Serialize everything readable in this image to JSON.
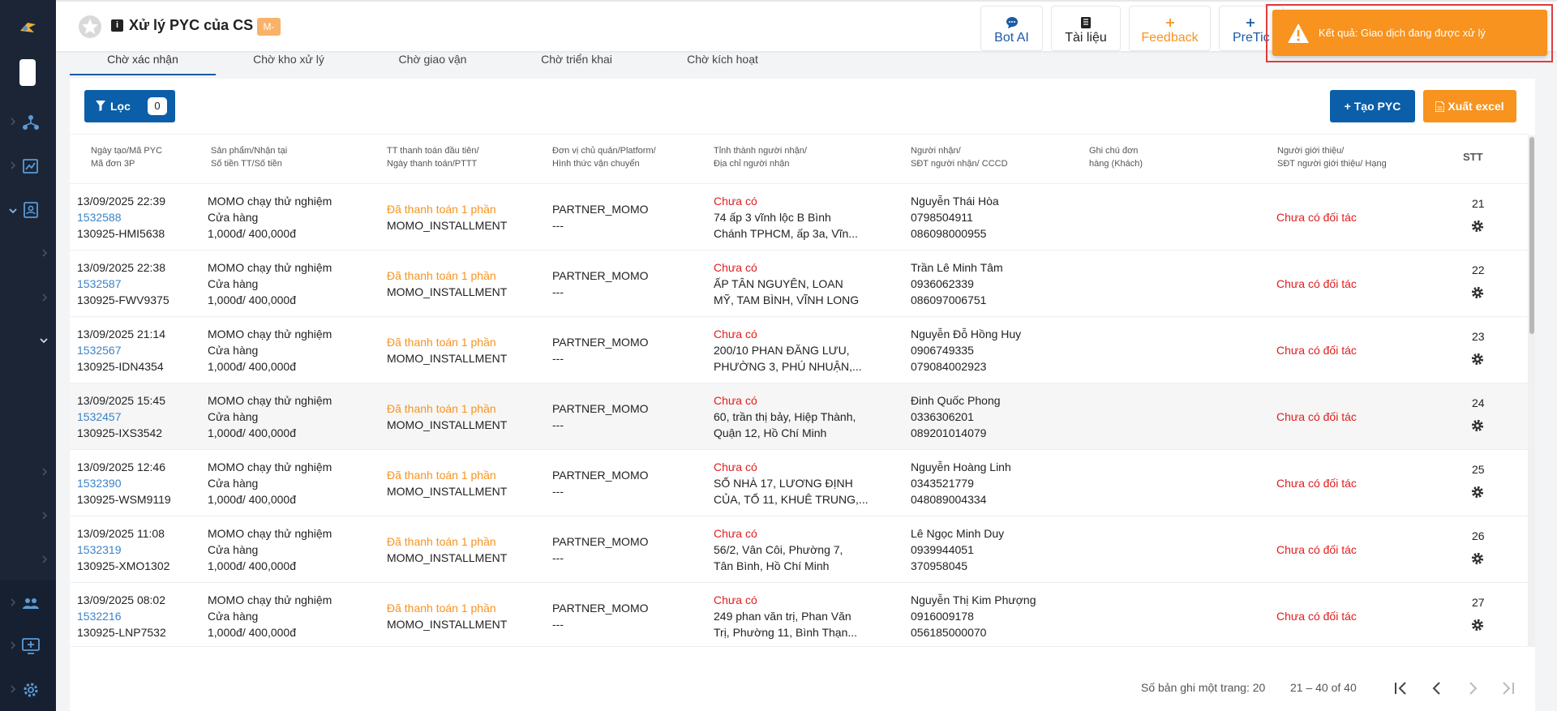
{
  "header": {
    "title": "Xử lý PYC của CS",
    "badge": "M-",
    "buttons": [
      {
        "label": "Bot AI"
      },
      {
        "label": "Tài liệu"
      },
      {
        "label": "Feedback"
      },
      {
        "label": "PreTic"
      }
    ]
  },
  "toast": {
    "message": "Kết quả: Giao dịch đang được xử lý"
  },
  "tabs": [
    {
      "label": "Chờ xác nhận",
      "active": true
    },
    {
      "label": "Chờ kho xử lý"
    },
    {
      "label": "Chờ giao vận"
    },
    {
      "label": "Chờ triển khai"
    },
    {
      "label": "Chờ kích hoạt"
    }
  ],
  "toolbar": {
    "filter_label": "Lọc",
    "filter_count": "0",
    "create_label": "+ Tạo PYC",
    "export_label": "Xuất excel"
  },
  "columns": [
    {
      "line1": "Ngày tạo/Mã PYC",
      "line2": "Mã đơn 3P"
    },
    {
      "line1": "Sản phẩm/Nhận tại",
      "line2": "Số tiền TT/Số tiền"
    },
    {
      "line1": "TT thanh toán đầu tiên/",
      "line2": "Ngày thanh toán/PTTT"
    },
    {
      "line1": "Đơn vị chủ quản/Platform/",
      "line2": "Hình thức vận chuyển"
    },
    {
      "line1": "Tỉnh thành người nhận/",
      "line2": "Địa chỉ người nhận"
    },
    {
      "line1": "Người nhận/",
      "line2": "SĐT người nhận/ CCCD"
    },
    {
      "line1": "Ghi chú đơn",
      "line2": "hàng (Khách)"
    },
    {
      "line1": "Người giới thiệu/",
      "line2": "SĐT người giới thiệu/ Hạng"
    },
    {
      "line1": "STT",
      "line2": ""
    }
  ],
  "rows": [
    {
      "date": "13/09/2025 22:39",
      "pyc": "1532588",
      "code3p": "130925-HMI5638",
      "product": "MOMO chạy thử nghiệm",
      "place": "Cửa hàng",
      "amount": "1,000đ/ 400,000đ",
      "pay_status": "Đã thanh toán 1 phần",
      "pay_method": "MOMO_INSTALLMENT",
      "unit": "PARTNER_MOMO",
      "ship": "---",
      "province": "Chưa có",
      "addr1": "74 ấp 3 vĩnh lộc B Bình",
      "addr2": "Chánh TPHCM, ấp 3a, Vĩn...",
      "recv_name": "Nguyễn Thái Hòa",
      "recv_phone": "0798504911",
      "recv_id": "086098000955",
      "note": "",
      "referrer": "Chưa có đối tác",
      "stt": "21"
    },
    {
      "date": "13/09/2025 22:38",
      "pyc": "1532587",
      "code3p": "130925-FWV9375",
      "product": "MOMO chạy thử nghiệm",
      "place": "Cửa hàng",
      "amount": "1,000đ/ 400,000đ",
      "pay_status": "Đã thanh toán 1 phần",
      "pay_method": "MOMO_INSTALLMENT",
      "unit": "PARTNER_MOMO",
      "ship": "---",
      "province": "Chưa có",
      "addr1": "ẤP TÂN NGUYÊN, LOAN",
      "addr2": "MỸ, TAM BÌNH, VĨNH LONG",
      "recv_name": "Trần Lê Minh Tâm",
      "recv_phone": "0936062339",
      "recv_id": "086097006751",
      "note": "",
      "referrer": "Chưa có đối tác",
      "stt": "22"
    },
    {
      "date": "13/09/2025 21:14",
      "pyc": "1532567",
      "code3p": "130925-IDN4354",
      "product": "MOMO chạy thử nghiệm",
      "place": "Cửa hàng",
      "amount": "1,000đ/ 400,000đ",
      "pay_status": "Đã thanh toán 1 phần",
      "pay_method": "MOMO_INSTALLMENT",
      "unit": "PARTNER_MOMO",
      "ship": "---",
      "province": "Chưa có",
      "addr1": "200/10 PHAN ĐĂNG LƯU,",
      "addr2": "PHƯỜNG 3, PHÚ NHUẬN,...",
      "recv_name": "Nguyễn Đỗ Hồng Huy",
      "recv_phone": "0906749335",
      "recv_id": "079084002923",
      "note": "",
      "referrer": "Chưa có đối tác",
      "stt": "23"
    },
    {
      "date": "13/09/2025 15:45",
      "pyc": "1532457",
      "code3p": "130925-IXS3542",
      "product": "MOMO chạy thử nghiệm",
      "place": "Cửa hàng",
      "amount": "1,000đ/ 400,000đ",
      "pay_status": "Đã thanh toán 1 phần",
      "pay_method": "MOMO_INSTALLMENT",
      "unit": "PARTNER_MOMO",
      "ship": "---",
      "province": "Chưa có",
      "addr1": "60, trần thị bảy, Hiệp Thành,",
      "addr2": "Quận 12, Hồ Chí Minh",
      "recv_name": "Đinh Quốc Phong",
      "recv_phone": "0336306201",
      "recv_id": "089201014079",
      "note": "",
      "referrer": "Chưa có đối tác",
      "stt": "24"
    },
    {
      "date": "13/09/2025 12:46",
      "pyc": "1532390",
      "code3p": "130925-WSM9119",
      "product": "MOMO chạy thử nghiệm",
      "place": "Cửa hàng",
      "amount": "1,000đ/ 400,000đ",
      "pay_status": "Đã thanh toán 1 phần",
      "pay_method": "MOMO_INSTALLMENT",
      "unit": "PARTNER_MOMO",
      "ship": "---",
      "province": "Chưa có",
      "addr1": "SỐ NHÀ 17, LƯƠNG ĐỊNH",
      "addr2": "CỦA, TỔ 11, KHUÊ TRUNG,...",
      "recv_name": "Nguyễn Hoàng Linh",
      "recv_phone": "0343521779",
      "recv_id": "048089004334",
      "note": "",
      "referrer": "Chưa có đối tác",
      "stt": "25"
    },
    {
      "date": "13/09/2025 11:08",
      "pyc": "1532319",
      "code3p": "130925-XMO1302",
      "product": "MOMO chạy thử nghiệm",
      "place": "Cửa hàng",
      "amount": "1,000đ/ 400,000đ",
      "pay_status": "Đã thanh toán 1 phần",
      "pay_method": "MOMO_INSTALLMENT",
      "unit": "PARTNER_MOMO",
      "ship": "---",
      "province": "Chưa có",
      "addr1": "56/2, Vân Côi, Phường 7,",
      "addr2": "Tân Bình, Hồ Chí Minh",
      "recv_name": "Lê Ngọc Minh Duy",
      "recv_phone": "0939944051",
      "recv_id": "370958045",
      "note": "",
      "referrer": "Chưa có đối tác",
      "stt": "26"
    },
    {
      "date": "13/09/2025 08:02",
      "pyc": "1532216",
      "code3p": "130925-LNP7532",
      "product": "MOMO chạy thử nghiệm",
      "place": "Cửa hàng",
      "amount": "1,000đ/ 400,000đ",
      "pay_status": "Đã thanh toán 1 phần",
      "pay_method": "MOMO_INSTALLMENT",
      "unit": "PARTNER_MOMO",
      "ship": "---",
      "province": "Chưa có",
      "addr1": "249 phan văn trị, Phan Văn",
      "addr2": "Trị, Phường 11, Bình Thạn...",
      "recv_name": "Nguyễn Thị Kim Phượng",
      "recv_phone": "0916009178",
      "recv_id": "056185000070",
      "note": "",
      "referrer": "Chưa có đối tác",
      "stt": "27"
    }
  ],
  "pagination": {
    "per_page_label": "Số bản ghi một trang: 20",
    "range": "21 – 40 of 40"
  },
  "colors": {
    "sidebar": "#1c2536",
    "primary": "#0b5ea8",
    "accent": "#f7931e",
    "link": "#3b83c8",
    "error": "#e11d1d"
  }
}
